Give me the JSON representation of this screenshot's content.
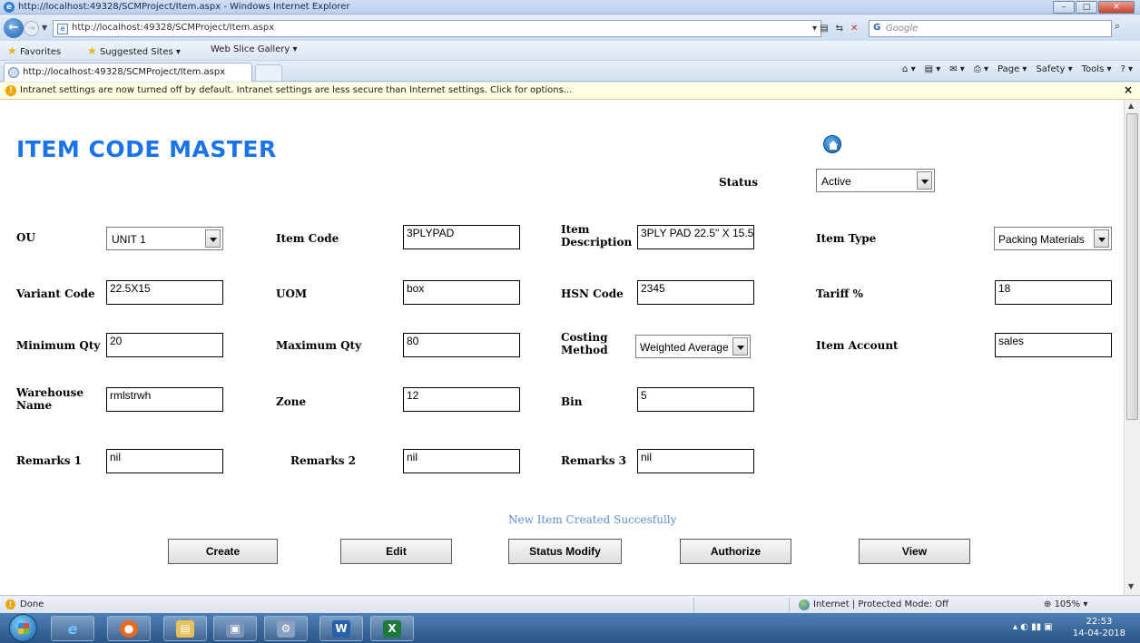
{
  "window": {
    "title": "http://localhost:49328/SCMProject/Item.aspx - Windows Internet Explorer",
    "min": "–",
    "max": "□",
    "close": "✕"
  },
  "browser": {
    "url": "http://localhost:49328/SCMProject/Item.aspx",
    "search_placeholder": "Google",
    "search_brand": "G",
    "favorites": "Favorites",
    "fav_links": [
      "Suggested Sites ▾",
      "Web Slice Gallery ▾"
    ],
    "tab_title": "http://localhost:49328/SCMProject/Item.aspx",
    "commands": [
      "Page ▾",
      "Safety ▾",
      "Tools ▾"
    ],
    "infobar_text": "Intranet settings are now turned off by default. Intranet settings are less secure than Internet settings. Click for options...",
    "status_text": "Done",
    "zone_text": "Internet | Protected Mode: Off",
    "zoom": "105%"
  },
  "form": {
    "title": "ITEM CODE MASTER",
    "status_label": "Status",
    "status_value": "Active",
    "labels": {
      "ou": "OU",
      "item_code": "Item Code",
      "item_description": "Item Description",
      "item_type": "Item Type",
      "variant_code": "Variant Code",
      "uom": "UOM",
      "hsn_code": "HSN Code",
      "tariff": "Tariff %",
      "minimum_qty": "Minimum Qty",
      "maximum_qty": "Maximum Qty",
      "costing_method": "Costing Method",
      "item_account": "Item Account",
      "warehouse_name": "Warehouse Name",
      "zone": "Zone",
      "bin": "Bin",
      "remarks1": "Remarks 1",
      "remarks2": "Remarks 2",
      "remarks3": "Remarks 3"
    },
    "values": {
      "ou": "UNIT 1",
      "item_code": "3PLYPAD",
      "item_description": "3PLY PAD 22.5\" X 15.5",
      "item_type": "Packing Materials",
      "variant_code": "22.5X15",
      "uom": "box",
      "hsn_code": "2345",
      "tariff": "18",
      "minimum_qty": "20",
      "maximum_qty": "80",
      "costing_method": "Weighted Average",
      "item_account": "sales",
      "warehouse_name": "rmlstrwh",
      "zone": "12",
      "bin": "5",
      "remarks1": "nil",
      "remarks2": "nil",
      "remarks3": "nil"
    },
    "message": "New Item Created Succesfully",
    "buttons": {
      "create": "Create",
      "edit": "Edit",
      "status_modify": "Status Modify",
      "authorize": "Authorize",
      "view": "View"
    }
  },
  "taskbar": {
    "time": "22:53",
    "date": "14-04-2018",
    "apps": [
      "e",
      "●",
      "▤",
      "▣",
      "⚙",
      "W",
      "X"
    ]
  }
}
